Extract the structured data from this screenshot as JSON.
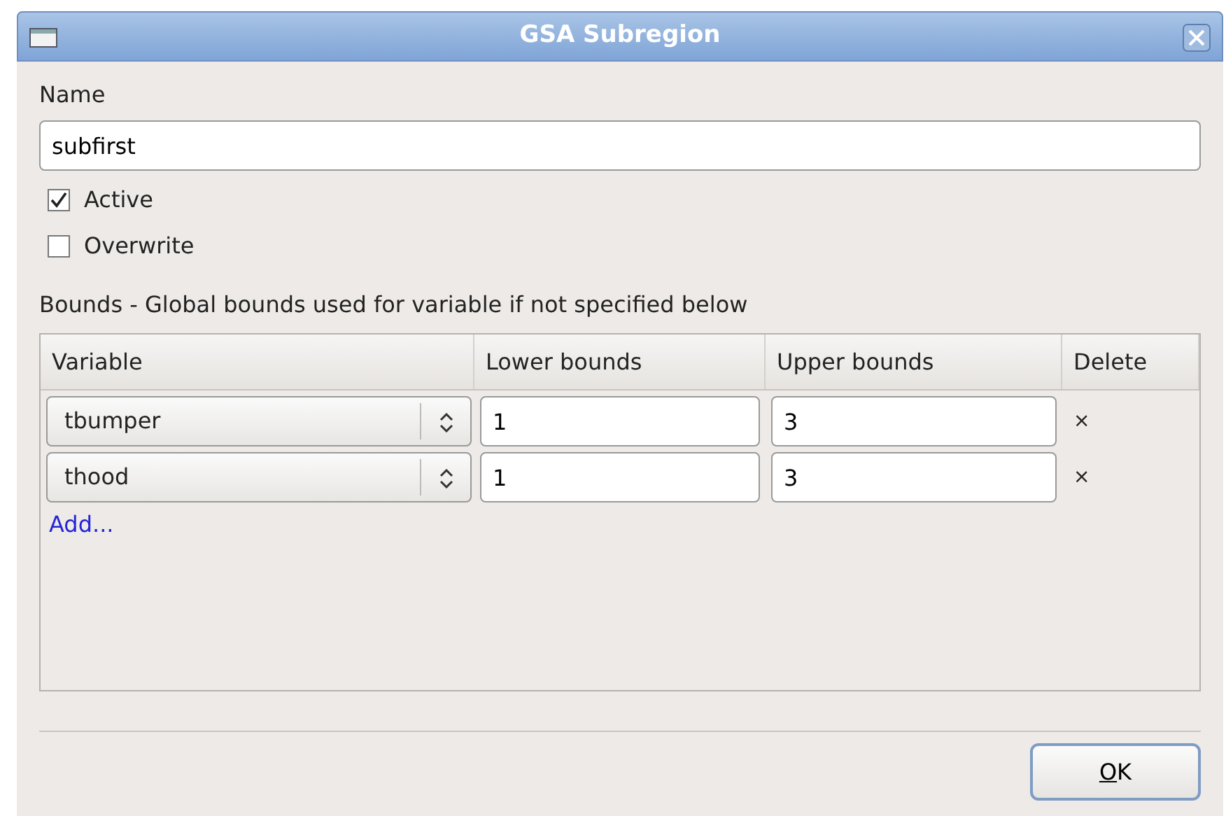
{
  "window": {
    "title": "GSA Subregion"
  },
  "name_label": "Name",
  "name_value": "subfirst",
  "options": [
    {
      "label": "Active",
      "checked": true
    },
    {
      "label": "Overwrite",
      "checked": false
    }
  ],
  "bounds_label": "Bounds - Global bounds used for variable if not specified below",
  "table": {
    "columns": [
      "Variable",
      "Lower bounds",
      "Upper bounds",
      "Delete"
    ],
    "rows": [
      {
        "variable": "tbumper",
        "lower": "1",
        "upper": "3",
        "delete": "×"
      },
      {
        "variable": "thood",
        "lower": "1",
        "upper": "3",
        "delete": "×"
      }
    ]
  },
  "add_link": "Add...",
  "buttons": [
    "OK"
  ]
}
